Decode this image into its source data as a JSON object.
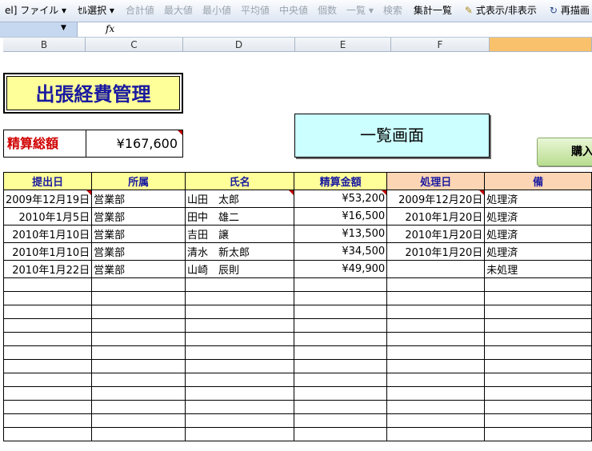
{
  "toolbar": {
    "items": [
      {
        "label": "el] ファイル ▾",
        "disabled": false
      },
      {
        "label": "ｾﾙ選択 ▾",
        "disabled": false
      },
      {
        "label": "合計値",
        "disabled": true
      },
      {
        "label": "最大値",
        "disabled": true
      },
      {
        "label": "最小値",
        "disabled": true
      },
      {
        "label": "平均値",
        "disabled": true
      },
      {
        "label": "中央値",
        "disabled": true
      },
      {
        "label": "個数",
        "disabled": true
      },
      {
        "label": "一覧 ▾",
        "disabled": true
      },
      {
        "label": "検索",
        "disabled": true
      },
      {
        "label": "集計一覧",
        "disabled": false
      },
      {
        "label": "式表示/非表示",
        "disabled": false,
        "icon": "formula-icon"
      },
      {
        "label": "再描画",
        "disabled": false,
        "icon": "refresh-icon"
      }
    ]
  },
  "formula_bar": {
    "fx": "fx"
  },
  "columns": [
    "B",
    "C",
    "D",
    "E",
    "F",
    ""
  ],
  "sheet": {
    "title": "出張経費管理",
    "total_label": "精算総額",
    "total_value": "¥167,600",
    "list_button": "一覧画面",
    "buy_button": "購入"
  },
  "table": {
    "headers": [
      "提出日",
      "所属",
      "氏名",
      "精算金額",
      "処理日",
      "備"
    ],
    "rows": [
      [
        "2009年12月19日",
        "営業部",
        "山田　太郎",
        "¥53,200",
        "2009年12月20日",
        "処理済"
      ],
      [
        "2010年1月5日",
        "営業部",
        "田中　雄二",
        "¥16,500",
        "2010年1月20日",
        "処理済"
      ],
      [
        "2010年1月10日",
        "営業部",
        "吉田　譲",
        "¥13,500",
        "2010年1月20日",
        "処理済"
      ],
      [
        "2010年1月10日",
        "営業部",
        "清水　新太郎",
        "¥34,500",
        "2010年1月20日",
        "処理済"
      ],
      [
        "2010年1月22日",
        "営業部",
        "山崎　辰則",
        "¥49,900",
        "",
        "未処理"
      ]
    ]
  }
}
